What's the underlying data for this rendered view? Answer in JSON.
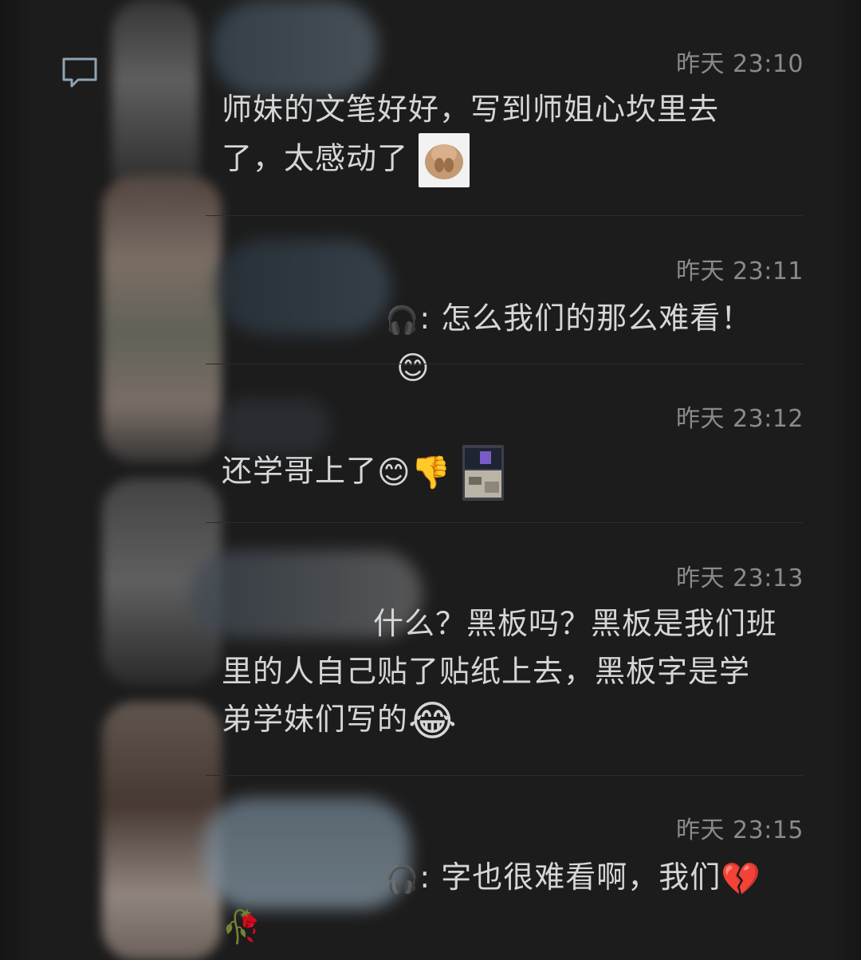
{
  "comments": [
    {
      "time": "昨天 23:10",
      "text": "师妹的文笔好好，写到师姐心坎里去了，太感动了",
      "line1": "师妹的文笔好好，写到师姐心坎里去",
      "line2": "了，太感动了"
    },
    {
      "time": "昨天 23:11",
      "text": ": 怎么我们的那么难看！",
      "headset_icon": "🎧",
      "emoji": "😊"
    },
    {
      "time": "昨天 23:12",
      "text": "还学哥上了",
      "emoji1": "😊",
      "emoji2": "👎"
    },
    {
      "time": "昨天 23:13",
      "line1": "什么？黑板吗？黑板是我们班",
      "line2": "里的人自己贴了贴纸上去，黑板字是学",
      "line3": "弟学妹们写的",
      "emoji": "😂"
    },
    {
      "time": "昨天 23:15",
      "text": ": 字也很难看啊，我们",
      "headset_icon": "🎧",
      "emoji1": "💔",
      "emoji2": "🥀"
    }
  ],
  "colors": {
    "background": "#1c1c1c",
    "text": "#d6d6d6",
    "timestamp": "#8a8a8a",
    "icon": "#8fa3b3"
  },
  "icons": {
    "comment": "comment-bubble-icon"
  }
}
